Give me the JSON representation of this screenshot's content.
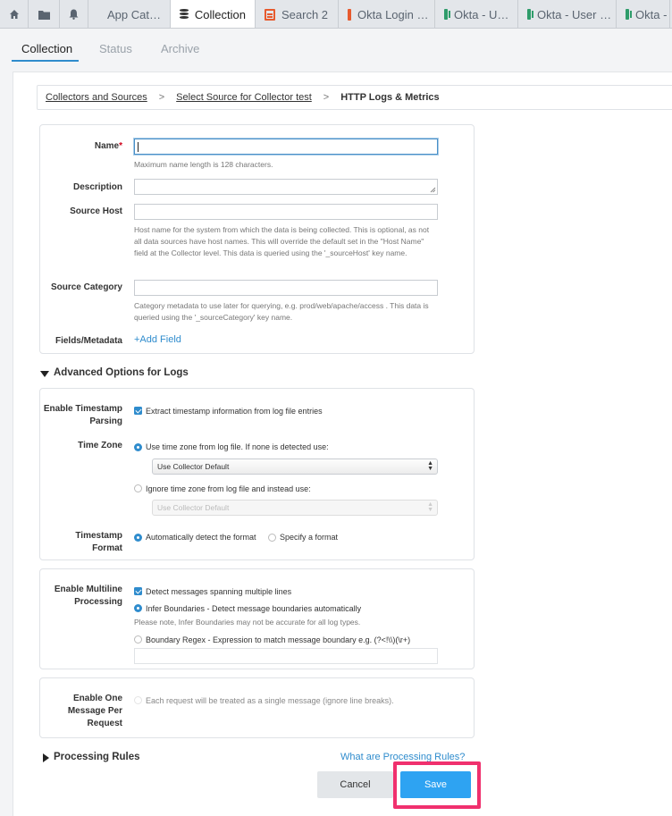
{
  "tabs": [
    {
      "label": "",
      "icon": "home-icon"
    },
    {
      "label": "",
      "icon": "folder-icon"
    },
    {
      "label": "",
      "icon": "bell-icon"
    },
    {
      "label": "App Cat…",
      "icon": "grid-icon"
    },
    {
      "label": "Collection",
      "icon": "database-icon",
      "active": true
    },
    {
      "label": "Search 2",
      "icon": "search-doc-icon"
    },
    {
      "label": "Okta Login …",
      "icon": "search-doc-icon"
    },
    {
      "label": "Okta - U…",
      "icon": "dashboard-icon"
    },
    {
      "label": "Okta - User …",
      "icon": "dashboard-icon"
    },
    {
      "label": "Okta -",
      "icon": "dashboard-icon"
    }
  ],
  "subtabs": {
    "collection": "Collection",
    "status": "Status",
    "archive": "Archive"
  },
  "breadcrumb": {
    "item1": "Collectors and Sources",
    "item2": "Select Source for Collector test",
    "current": "HTTP Logs & Metrics",
    "sep": ">"
  },
  "form": {
    "name_label": "Name",
    "name_required": "*",
    "name_value": "",
    "name_hint": "Maximum name length is 128 characters.",
    "description_label": "Description",
    "source_host_label": "Source Host",
    "source_host_hint": "Host name for the system from which the data is being collected. This is optional, as not all data sources have host names. This will override the default set in the \"Host Name\" field at the Collector level. This data is queried using the '_sourceHost' key name.",
    "source_category_label": "Source Category",
    "source_category_hint": "Category metadata to use later for querying, e.g. prod/web/apache/access . This data is queried using the '_sourceCategory' key name.",
    "fields_label": "Fields/Metadata",
    "add_field": "+Add Field"
  },
  "advanced": {
    "title": "Advanced Options for Logs",
    "ts_parsing_label": "Enable Timestamp Parsing",
    "ts_parsing_option": "Extract timestamp information from log file entries",
    "timezone_label": "Time Zone",
    "tz_option1": "Use time zone from log file. If none is detected use:",
    "tz_select1": "Use Collector Default",
    "tz_option2": "Ignore time zone from log file and instead use:",
    "tz_select2": "Use Collector Default",
    "ts_format_label": "Timestamp Format",
    "ts_format_auto": "Automatically detect the format",
    "ts_format_specify": "Specify a format",
    "multiline_label": "Enable Multiline Processing",
    "multiline_option": "Detect messages spanning multiple lines",
    "infer_option": "Infer Boundaries - Detect message boundaries automatically",
    "infer_note": "Please note, Infer Boundaries may not be accurate for all log types.",
    "regex_option": "Boundary Regex - Expression to match message boundary e.g. (?<!\\\\)(\\r+)",
    "one_msg_label": "Enable One Message Per Request",
    "one_msg_option": "Each request will be treated as a single message (ignore line breaks)."
  },
  "processing": {
    "title": "Processing Rules",
    "link": "What are Processing Rules?"
  },
  "buttons": {
    "cancel": "Cancel",
    "save": "Save"
  },
  "colors": {
    "accent": "#2f8ccd",
    "save": "#2ea3f2",
    "highlight": "#f0306e",
    "required": "#d0021b"
  }
}
